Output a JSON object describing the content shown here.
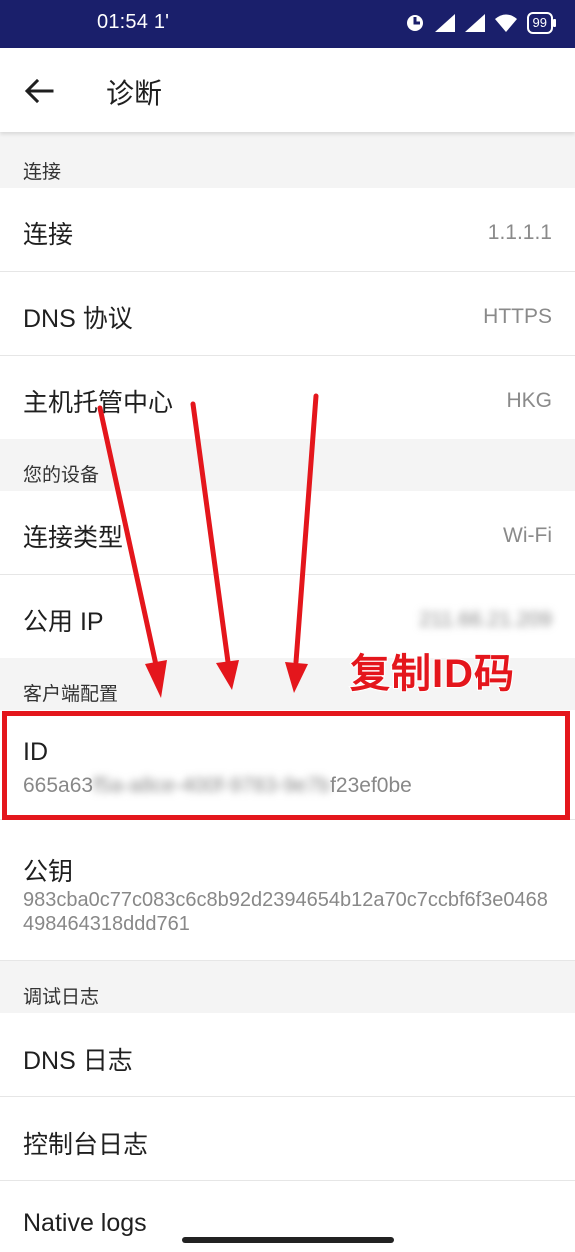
{
  "status_bar": {
    "time": "01:54",
    "time_suffix": "1'",
    "battery": "99"
  },
  "app_bar": {
    "title": "诊断"
  },
  "sections": {
    "connection": {
      "header": "连接",
      "rows": [
        {
          "label": "连接",
          "value": "1.1.1.1"
        },
        {
          "label": "DNS 协议",
          "value": "HTTPS"
        },
        {
          "label": "主机托管中心",
          "value": "HKG"
        }
      ]
    },
    "device": {
      "header": "您的设备",
      "rows": [
        {
          "label": "连接类型",
          "value": "Wi-Fi"
        },
        {
          "label": "公用 IP",
          "value": "211.66.21.209"
        }
      ]
    },
    "client": {
      "header": "客户端配置",
      "id_label": "ID",
      "id_prefix": "665a63",
      "id_hidden": "f5a-a8ce-400f-9783-9e7b",
      "id_suffix": "f23ef0be",
      "pubkey_label": "公钥",
      "pubkey_value": "983cba0c77c083c6c8b92d2394654b12a70c7ccbf6f3e0468498464318ddd761"
    },
    "debug": {
      "header": "调试日志",
      "rows": [
        {
          "label": "DNS 日志"
        },
        {
          "label": "控制台日志"
        },
        {
          "label": "Native logs"
        }
      ]
    }
  },
  "annotation": {
    "text": "复制ID码",
    "color": "#e4161c"
  }
}
